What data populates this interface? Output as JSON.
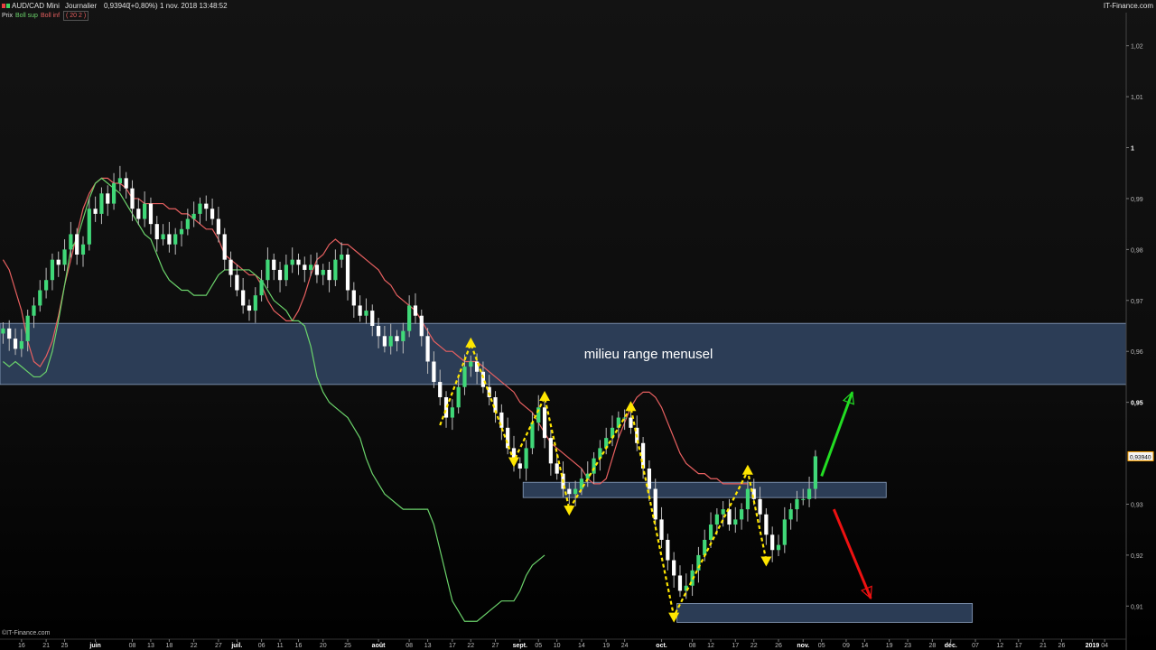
{
  "header": {
    "symbol": "AUD/CAD Mini",
    "period": "Journalier",
    "price": "0,93940",
    "change": "(+0,80%)",
    "datetime": "1 nov. 2018 13:48:52",
    "site": "IT-Finance.com",
    "colors": {
      "up_square": "#e84040",
      "down_square": "#40d060"
    }
  },
  "indicators": {
    "prix": "Prix",
    "boll_sup": "Boll sup",
    "boll_inf": "Boll inf",
    "params": "( 20 2 )",
    "colors": {
      "boll_sup": "#6bd36b",
      "boll_inf": "#e86060"
    }
  },
  "credit": "©IT-Finance.com",
  "chart_data": {
    "type": "candlestick",
    "y_axis": {
      "range": [
        0.9035,
        1.0265
      ],
      "ticks": [
        {
          "value": 1.02,
          "label": "1,02"
        },
        {
          "value": 1.01,
          "label": "1,01"
        },
        {
          "value": 1.0,
          "label": "1"
        },
        {
          "value": 0.99,
          "label": "0,99"
        },
        {
          "value": 0.98,
          "label": "0,98"
        },
        {
          "value": 0.97,
          "label": "0,97"
        },
        {
          "value": 0.96,
          "label": "0,96"
        },
        {
          "value": 0.95,
          "label": "0,95"
        },
        {
          "value": 0.93,
          "label": "0,93"
        },
        {
          "value": 0.92,
          "label": "0,92"
        },
        {
          "value": 0.91,
          "label": "0,91"
        }
      ],
      "bold_labels": [
        "1",
        "0,95"
      ],
      "current_price_label": "0,93940",
      "current_price": 0.9394
    },
    "x_axis": {
      "ticks": [
        {
          "label": "16",
          "bar": 3
        },
        {
          "label": "21",
          "bar": 7
        },
        {
          "label": "25",
          "bar": 10
        },
        {
          "label": "juin",
          "bar": 15,
          "major": true
        },
        {
          "label": "08",
          "bar": 21
        },
        {
          "label": "13",
          "bar": 24
        },
        {
          "label": "18",
          "bar": 27
        },
        {
          "label": "22",
          "bar": 31
        },
        {
          "label": "27",
          "bar": 35
        },
        {
          "label": "juil.",
          "bar": 38,
          "major": true
        },
        {
          "label": "06",
          "bar": 42
        },
        {
          "label": "11",
          "bar": 45
        },
        {
          "label": "16",
          "bar": 48
        },
        {
          "label": "20",
          "bar": 52
        },
        {
          "label": "25",
          "bar": 56
        },
        {
          "label": "août",
          "bar": 61,
          "major": true
        },
        {
          "label": "08",
          "bar": 66
        },
        {
          "label": "13",
          "bar": 69
        },
        {
          "label": "17",
          "bar": 73
        },
        {
          "label": "22",
          "bar": 76
        },
        {
          "label": "27",
          "bar": 80
        },
        {
          "label": "sept.",
          "bar": 84,
          "major": true
        },
        {
          "label": "05",
          "bar": 87
        },
        {
          "label": "10",
          "bar": 90
        },
        {
          "label": "14",
          "bar": 94
        },
        {
          "label": "19",
          "bar": 98
        },
        {
          "label": "24",
          "bar": 101
        },
        {
          "label": "oct.",
          "bar": 107,
          "major": true
        },
        {
          "label": "08",
          "bar": 112
        },
        {
          "label": "12",
          "bar": 115
        },
        {
          "label": "17",
          "bar": 119
        },
        {
          "label": "22",
          "bar": 122
        },
        {
          "label": "26",
          "bar": 126
        },
        {
          "label": "nov.",
          "bar": 130,
          "major": true
        },
        {
          "label": "05",
          "bar": 133
        },
        {
          "label": "09",
          "bar": 137
        },
        {
          "label": "14",
          "bar": 140
        },
        {
          "label": "19",
          "bar": 144
        },
        {
          "label": "23",
          "bar": 147
        },
        {
          "label": "28",
          "bar": 151
        },
        {
          "label": "déc.",
          "bar": 154,
          "major": true
        },
        {
          "label": "07",
          "bar": 158
        },
        {
          "label": "12",
          "bar": 162
        },
        {
          "label": "17",
          "bar": 165
        },
        {
          "label": "21",
          "bar": 169
        },
        {
          "label": "26",
          "bar": 172
        },
        {
          "label": "2019",
          "bar": 177,
          "major": true
        },
        {
          "label": "04",
          "bar": 179
        }
      ]
    },
    "bars_total": 183,
    "close": [
      0.9645,
      0.9625,
      0.9605,
      0.962,
      0.967,
      0.969,
      0.972,
      0.974,
      0.978,
      0.977,
      0.98,
      0.983,
      0.979,
      0.981,
      0.988,
      0.987,
      0.991,
      0.989,
      0.993,
      0.994,
      0.992,
      0.988,
      0.986,
      0.989,
      0.985,
      0.982,
      0.983,
      0.981,
      0.983,
      0.984,
      0.986,
      0.987,
      0.989,
      0.988,
      0.986,
      0.983,
      0.978,
      0.975,
      0.972,
      0.969,
      0.968,
      0.971,
      0.974,
      0.978,
      0.976,
      0.974,
      0.977,
      0.978,
      0.977,
      0.976,
      0.977,
      0.975,
      0.976,
      0.974,
      0.978,
      0.979,
      0.972,
      0.969,
      0.967,
      0.968,
      0.965,
      0.963,
      0.961,
      0.963,
      0.962,
      0.964,
      0.969,
      0.967,
      0.963,
      0.958,
      0.954,
      0.951,
      0.947,
      0.949,
      0.953,
      0.957,
      0.958,
      0.956,
      0.953,
      0.951,
      0.948,
      0.945,
      0.941,
      0.938,
      0.937,
      0.941,
      0.946,
      0.949,
      0.943,
      0.938,
      0.936,
      0.933,
      0.932,
      0.933,
      0.935,
      0.936,
      0.939,
      0.941,
      0.943,
      0.945,
      0.947,
      0.947,
      0.945,
      0.942,
      0.937,
      0.933,
      0.927,
      0.923,
      0.919,
      0.916,
      0.913,
      0.914,
      0.917,
      0.92,
      0.923,
      0.926,
      0.928,
      0.929,
      0.926,
      0.927,
      0.929,
      0.933,
      0.931,
      0.928,
      0.924,
      0.921,
      0.922,
      0.927,
      0.929,
      0.931,
      0.931,
      0.933,
      0.9394
    ],
    "bollinger_upper": [
      0.978,
      0.976,
      0.972,
      0.968,
      0.962,
      0.958,
      0.957,
      0.959,
      0.962,
      0.967,
      0.973,
      0.978,
      0.983,
      0.988,
      0.991,
      0.993,
      0.994,
      0.994,
      0.993,
      0.993,
      0.992,
      0.99,
      0.99,
      0.989,
      0.989,
      0.989,
      0.989,
      0.988,
      0.988,
      0.987,
      0.987,
      0.986,
      0.985,
      0.984,
      0.984,
      0.982,
      0.979,
      0.978,
      0.977,
      0.976,
      0.975,
      0.975,
      0.973,
      0.97,
      0.968,
      0.967,
      0.966,
      0.966,
      0.968,
      0.971,
      0.975,
      0.978,
      0.979,
      0.981,
      0.982,
      0.981,
      0.981,
      0.98,
      0.979,
      0.978,
      0.977,
      0.976,
      0.974,
      0.973,
      0.971,
      0.97,
      0.969,
      0.968,
      0.966,
      0.964,
      0.962,
      0.961,
      0.96,
      0.96,
      0.959,
      0.958,
      0.958,
      0.958,
      0.957,
      0.956,
      0.955,
      0.954,
      0.953,
      0.952,
      0.95,
      0.949,
      0.948,
      0.946,
      0.944,
      0.942,
      0.941,
      0.94,
      0.939,
      0.938,
      0.937,
      0.935,
      0.934,
      0.934,
      0.935,
      0.939,
      0.943,
      0.946,
      0.949,
      0.951,
      0.952,
      0.952,
      0.951,
      0.949,
      0.946,
      0.943,
      0.94,
      0.938,
      0.937,
      0.936,
      0.936,
      0.935,
      0.935,
      0.934,
      0.934,
      0.934,
      0.934,
      0.934
    ],
    "bollinger_lower": [
      0.958,
      0.957,
      0.958,
      0.957,
      0.956,
      0.955,
      0.955,
      0.956,
      0.96,
      0.966,
      0.973,
      0.98,
      0.982,
      0.986,
      0.99,
      0.993,
      0.994,
      0.993,
      0.992,
      0.991,
      0.989,
      0.987,
      0.985,
      0.983,
      0.982,
      0.979,
      0.976,
      0.974,
      0.973,
      0.972,
      0.972,
      0.971,
      0.971,
      0.971,
      0.973,
      0.975,
      0.976,
      0.976,
      0.976,
      0.976,
      0.976,
      0.975,
      0.974,
      0.972,
      0.97,
      0.969,
      0.968,
      0.966,
      0.966,
      0.965,
      0.961,
      0.955,
      0.952,
      0.95,
      0.949,
      0.948,
      0.947,
      0.945,
      0.943,
      0.939,
      0.936,
      0.934,
      0.932,
      0.931,
      0.93,
      0.929,
      0.929,
      0.929,
      0.929,
      0.929,
      0.926,
      0.921,
      0.916,
      0.911,
      0.909,
      0.907,
      0.907,
      0.907,
      0.908,
      0.909,
      0.91,
      0.911,
      0.911,
      0.911,
      0.913,
      0.916,
      0.918,
      0.919,
      0.92
    ],
    "rectangles": [
      {
        "y_top": 0.9655,
        "y_bottom": 0.9535,
        "from_bar": 0,
        "to_bar": 183,
        "label": "milieu range menusel"
      },
      {
        "y_top": 0.9343,
        "y_bottom": 0.9313,
        "from_bar": 85,
        "to_bar": 143,
        "label": ""
      },
      {
        "y_top": 0.9105,
        "y_bottom": 0.9068,
        "from_bar": 110,
        "to_bar": 157,
        "label": ""
      }
    ],
    "zigzag": [
      {
        "bar": 71,
        "value": 0.9455
      },
      {
        "bar": 76,
        "value": 0.9615
      },
      {
        "bar": 83,
        "value": 0.9385
      },
      {
        "bar": 88,
        "value": 0.951
      },
      {
        "bar": 92,
        "value": 0.929
      },
      {
        "bar": 102,
        "value": 0.949
      },
      {
        "bar": 109,
        "value": 0.908
      },
      {
        "bar": 121,
        "value": 0.9365
      },
      {
        "bar": 124,
        "value": 0.919
      }
    ],
    "arrows": [
      {
        "from_bar": 133,
        "from_value": 0.9355,
        "to_bar": 138,
        "to_value": 0.952,
        "color": "#22dd22"
      },
      {
        "from_bar": 135,
        "from_value": 0.929,
        "to_bar": 141,
        "to_value": 0.9115,
        "color": "#ee1111"
      }
    ],
    "colors": {
      "bull": "#40d878",
      "bear": "#ffffff",
      "wick": "#bbbbbb",
      "rect_fill": "#324664",
      "zigzag": "#ffe600",
      "axis_text": "#bbbbbb"
    }
  }
}
